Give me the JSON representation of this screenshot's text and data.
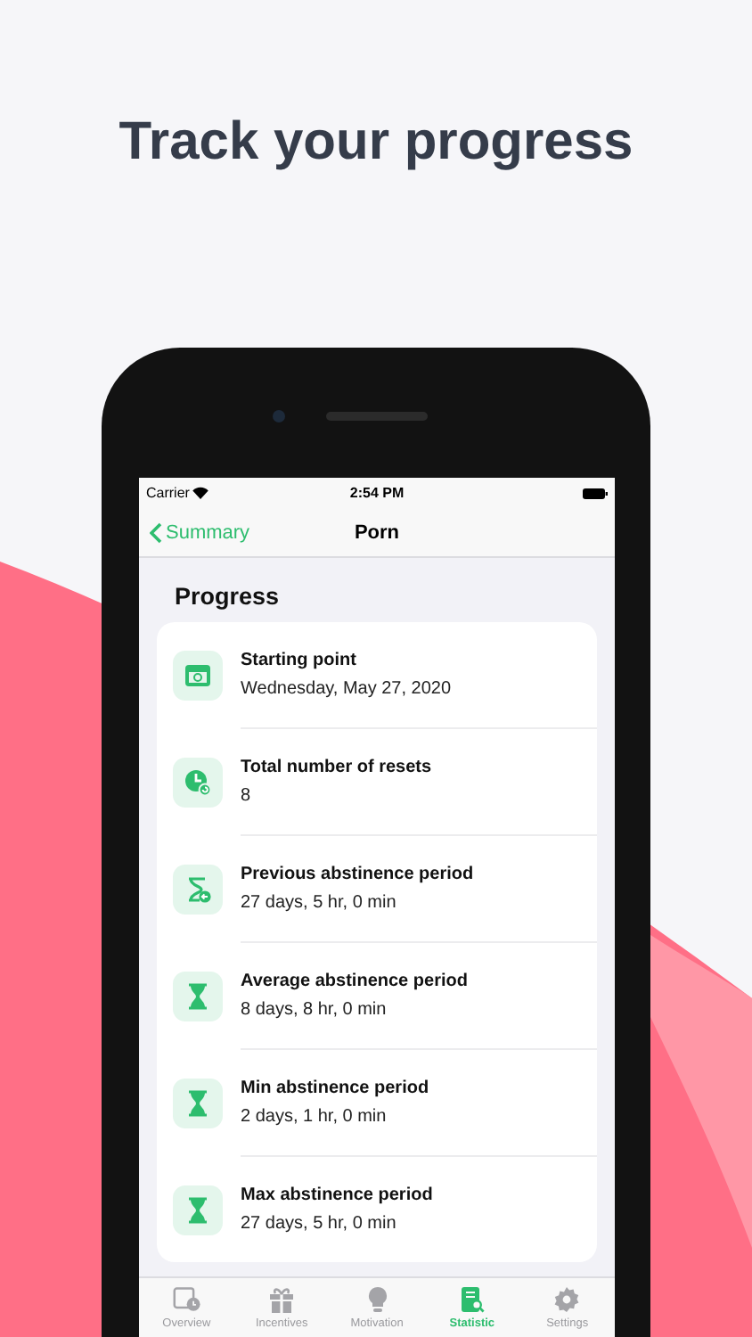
{
  "heading": "Track your progress",
  "status_bar": {
    "carrier": "Carrier",
    "time": "2:54 PM"
  },
  "nav": {
    "back": "Summary",
    "title": "Porn"
  },
  "section": "Progress",
  "rows": [
    {
      "kind": "calendar",
      "label": "Starting point",
      "value": "Wednesday, May 27, 2020"
    },
    {
      "kind": "reset",
      "label": "Total number of resets",
      "value": "8"
    },
    {
      "kind": "hourglass-back",
      "label": "Previous abstinence period",
      "value": "27 days, 5 hr, 0 min"
    },
    {
      "kind": "hourglass",
      "label": "Average abstinence period",
      "value": "8 days, 8 hr, 0 min"
    },
    {
      "kind": "hourglass",
      "label": "Min abstinence period",
      "value": "2 days, 1 hr, 0 min"
    },
    {
      "kind": "hourglass",
      "label": "Max abstinence period",
      "value": "27 days, 5 hr, 0 min"
    }
  ],
  "tabs": [
    {
      "kind": "overview",
      "label": "Overview",
      "selected": false
    },
    {
      "kind": "incentives",
      "label": "Incentives",
      "selected": false
    },
    {
      "kind": "motivation",
      "label": "Motivation",
      "selected": false
    },
    {
      "kind": "statistic",
      "label": "Statistic",
      "selected": true
    },
    {
      "kind": "settings",
      "label": "Settings",
      "selected": false
    }
  ]
}
